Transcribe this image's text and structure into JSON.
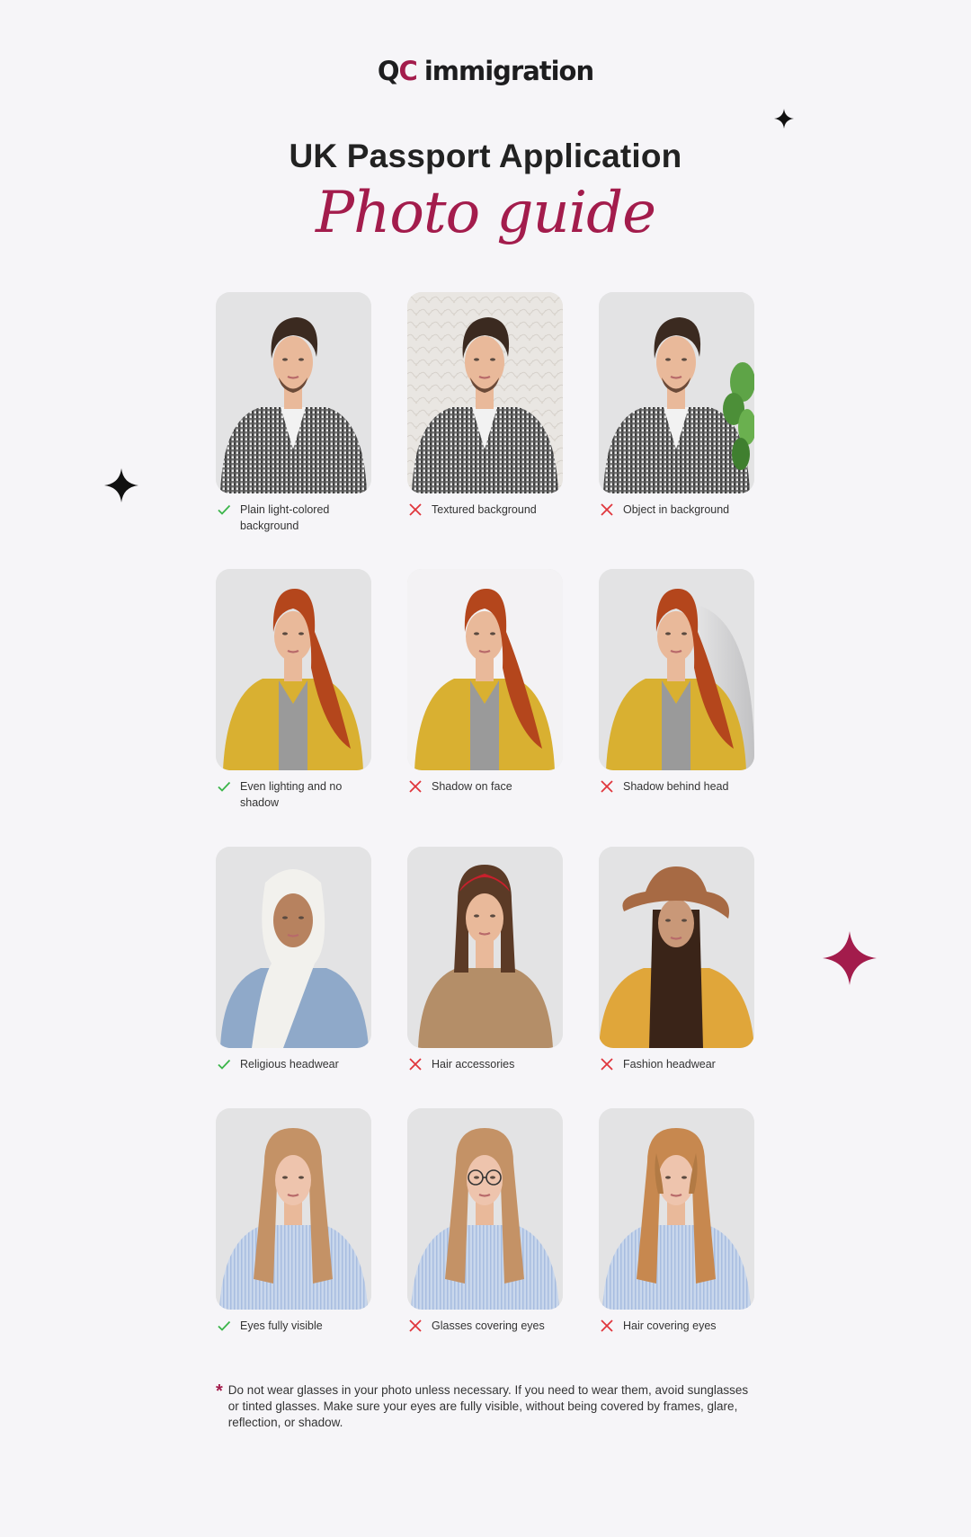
{
  "brand": {
    "logo_mark_q": "Q",
    "logo_mark_c": "C",
    "logo_text": "immigration",
    "accent_color": "#a31c4c"
  },
  "header": {
    "title": "UK Passport Application",
    "subtitle": "Photo guide"
  },
  "guide": {
    "rows": [
      {
        "topic": "background",
        "items": [
          {
            "status": "ok",
            "status_icon": "check-icon",
            "caption": "Plain light-colored background",
            "subject": "man-checked-shirt",
            "variant": "plain"
          },
          {
            "status": "bad",
            "status_icon": "cross-icon",
            "caption": "Textured background",
            "subject": "man-checked-shirt",
            "variant": "textured"
          },
          {
            "status": "bad",
            "status_icon": "cross-icon",
            "caption": "Object in background",
            "subject": "man-checked-shirt",
            "variant": "plant"
          }
        ]
      },
      {
        "topic": "lighting",
        "items": [
          {
            "status": "ok",
            "status_icon": "check-icon",
            "caption": "Even lighting and no shadow",
            "subject": "redhead-yellow-cardigan",
            "variant": "plain"
          },
          {
            "status": "bad",
            "status_icon": "cross-icon",
            "caption": "Shadow on face",
            "subject": "redhead-yellow-cardigan",
            "variant": "bright"
          },
          {
            "status": "bad",
            "status_icon": "cross-icon",
            "caption": "Shadow behind head",
            "subject": "redhead-yellow-cardigan",
            "variant": "shadow"
          }
        ]
      },
      {
        "topic": "headwear",
        "items": [
          {
            "status": "ok",
            "status_icon": "check-icon",
            "caption": "Religious headwear",
            "subject": "woman-hijab-denim",
            "variant": "hijab"
          },
          {
            "status": "bad",
            "status_icon": "cross-icon",
            "caption": "Hair accessories",
            "subject": "woman-red-headband",
            "variant": "headband"
          },
          {
            "status": "bad",
            "status_icon": "cross-icon",
            "caption": "Fashion headwear",
            "subject": "woman-brown-hat",
            "variant": "hat"
          }
        ]
      },
      {
        "topic": "eyes",
        "items": [
          {
            "status": "ok",
            "status_icon": "check-icon",
            "caption": "Eyes fully visible",
            "subject": "blonde-striped-shirt",
            "variant": "plain"
          },
          {
            "status": "bad",
            "status_icon": "cross-icon",
            "caption": "Glasses covering eyes",
            "subject": "blonde-striped-shirt",
            "variant": "glasses"
          },
          {
            "status": "bad",
            "status_icon": "cross-icon",
            "caption": "Hair covering eyes",
            "subject": "blonde-striped-shirt",
            "variant": "hair-over"
          }
        ]
      }
    ],
    "status_colors": {
      "ok": "#3bb54a",
      "bad": "#e0363c"
    }
  },
  "footnote": {
    "marker": "*",
    "text": "Do not wear glasses in your photo unless necessary. If you need to wear them, avoid sunglasses or tinted glasses. Make sure your eyes are fully visible, without being covered by frames, glare, reflection, or shadow."
  },
  "decorations": [
    {
      "icon": "sparkle-icon",
      "color": "#111111"
    },
    {
      "icon": "sparkle-icon",
      "color": "#111111"
    },
    {
      "icon": "sparkle-icon",
      "color": "#a31c4c"
    }
  ]
}
